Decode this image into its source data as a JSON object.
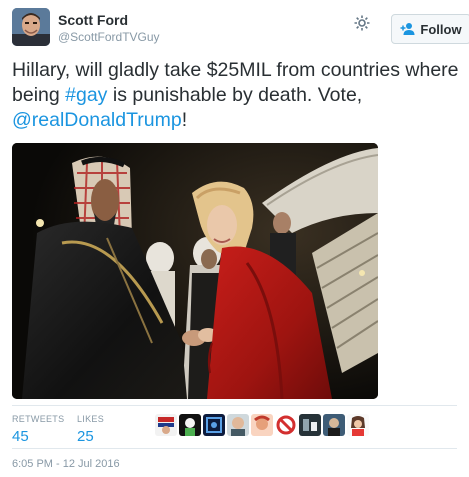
{
  "tweet": {
    "author": {
      "display_name": "Scott Ford",
      "handle": "@ScottFordTVGuy"
    },
    "follow_label": "Follow",
    "text_parts": {
      "part1": "Hillary, will gladly take $25MIL from countries where being ",
      "hashtag": "#gay",
      "part2": " is punishable by death. Vote, ",
      "mention": "@realDonaldTrump",
      "part3": "!"
    },
    "stats": {
      "retweets_label": "RETWEETS",
      "retweets_value": "45",
      "likes_label": "LIKES",
      "likes_value": "25"
    },
    "timestamp": "6:05 PM - 12 Jul 2016"
  },
  "colors": {
    "link": "#1b95e0",
    "text": "#292f33",
    "muted": "#8899a6"
  },
  "icons": [
    "gear-icon",
    "follow-person-icon"
  ]
}
